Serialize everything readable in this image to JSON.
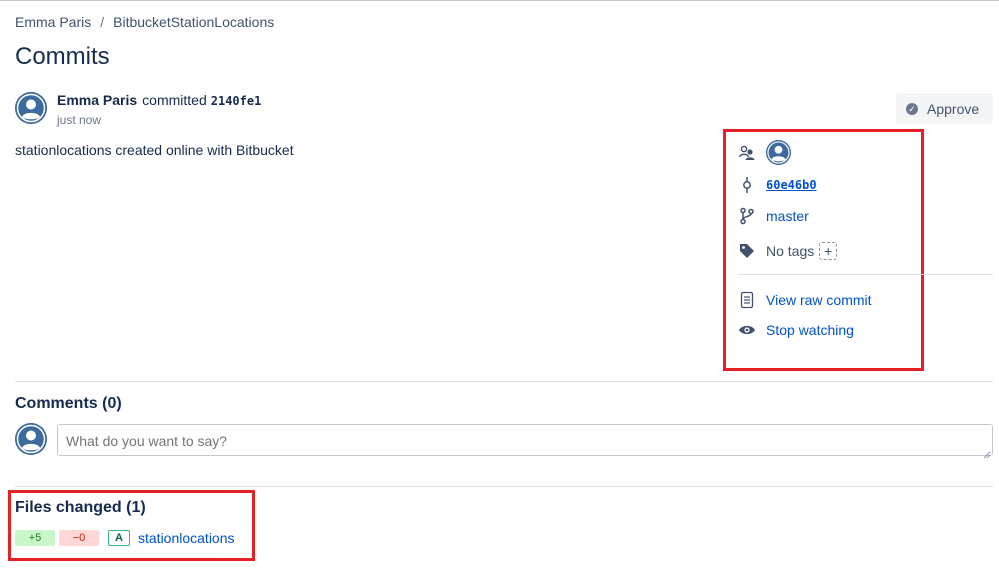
{
  "breadcrumb": {
    "owner": "Emma Paris",
    "separator": "/",
    "repo": "BitbucketStationLocations"
  },
  "page_title": "Commits",
  "commit": {
    "author": "Emma Paris",
    "verb": "committed",
    "hash": "2140fe1",
    "time": "just now",
    "message": "stationlocations created online with Bitbucket"
  },
  "approve_button": {
    "label": "Approve",
    "icon": "check-circle-icon"
  },
  "sidebar": {
    "participants_icon": "participants-icon",
    "parent_commit": "60e46b0",
    "branch": "master",
    "tags_label": "No tags",
    "add_tag_label": "+",
    "view_raw_commit": "View raw commit",
    "stop_watching": "Stop watching"
  },
  "comments": {
    "title": "Comments (0)",
    "placeholder": "What do you want to say?"
  },
  "files_changed": {
    "title": "Files changed (1)",
    "files": [
      {
        "added": "+5",
        "removed": "−0",
        "status": "A",
        "name": "stationlocations"
      }
    ]
  },
  "colors": {
    "link": "#0052CC",
    "text": "#172B4D",
    "highlight_box": "#E32127",
    "avatar": "#3E6B9E"
  }
}
